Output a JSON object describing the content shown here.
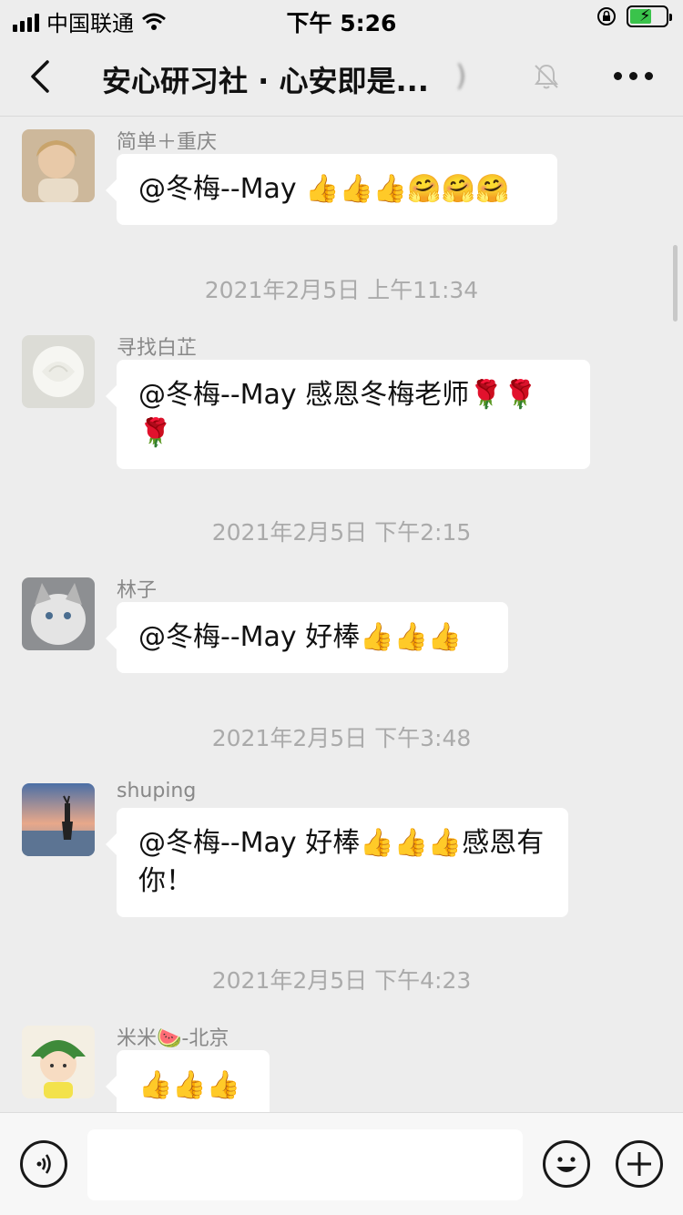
{
  "status_bar": {
    "carrier": "中国联通",
    "time": "下午 5:26"
  },
  "nav": {
    "title": "安心研习社 · 心安即是...",
    "title_suffix": ")"
  },
  "messages": [
    {
      "sender": "简单＋重庆",
      "text": "@冬梅--May 👍👍👍🤗🤗🤗"
    },
    {
      "timestamp": "2021年2月5日 上午11:34"
    },
    {
      "sender": "寻找白芷",
      "text": "@冬梅--May 感恩冬梅老师🌹🌹🌹"
    },
    {
      "timestamp": "2021年2月5日 下午2:15"
    },
    {
      "sender": "林子",
      "text": "@冬梅--May 好棒👍👍👍"
    },
    {
      "timestamp": "2021年2月5日 下午3:48"
    },
    {
      "sender": "shuping",
      "text": "@冬梅--May 好棒👍👍👍感恩有你！"
    },
    {
      "timestamp": "2021年2月5日 下午4:23"
    },
    {
      "sender": "米米🍉-北京",
      "text": "👍👍👍"
    }
  ],
  "input": {
    "placeholder": ""
  },
  "colors": {
    "background": "#ededed",
    "bubble": "#ffffff",
    "battery": "#3ac34b"
  }
}
